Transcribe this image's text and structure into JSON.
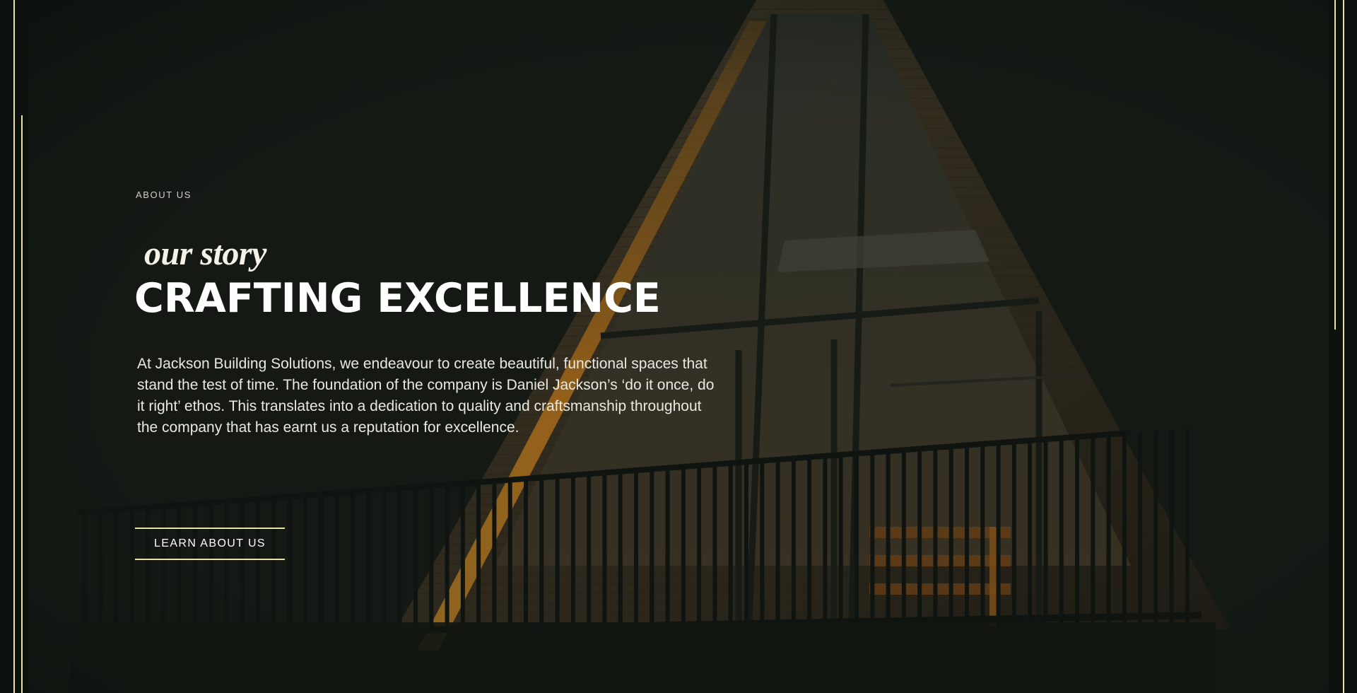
{
  "section": {
    "eyebrow": "ABOUT US",
    "script_title": "our story",
    "title": "CRAFTING EXCELLENCE",
    "body": "At Jackson Building Solutions, we endeavour to create beautiful, functional spaces that stand the test of time. The foundation of the company is Daniel Jackson’s ‘do it once, do it right’ ethos. This translates into a dedication to quality and craftsmanship throughout the company that has earnt us a reputation for excellence.",
    "cta_label": "LEARN ABOUT US"
  },
  "colors": {
    "background": "#131913",
    "accent_gold": "#e8e0a4",
    "text_primary": "#ffffff",
    "window_glow": "#e08a1e"
  },
  "background_image": "a-frame-cabin-photo"
}
